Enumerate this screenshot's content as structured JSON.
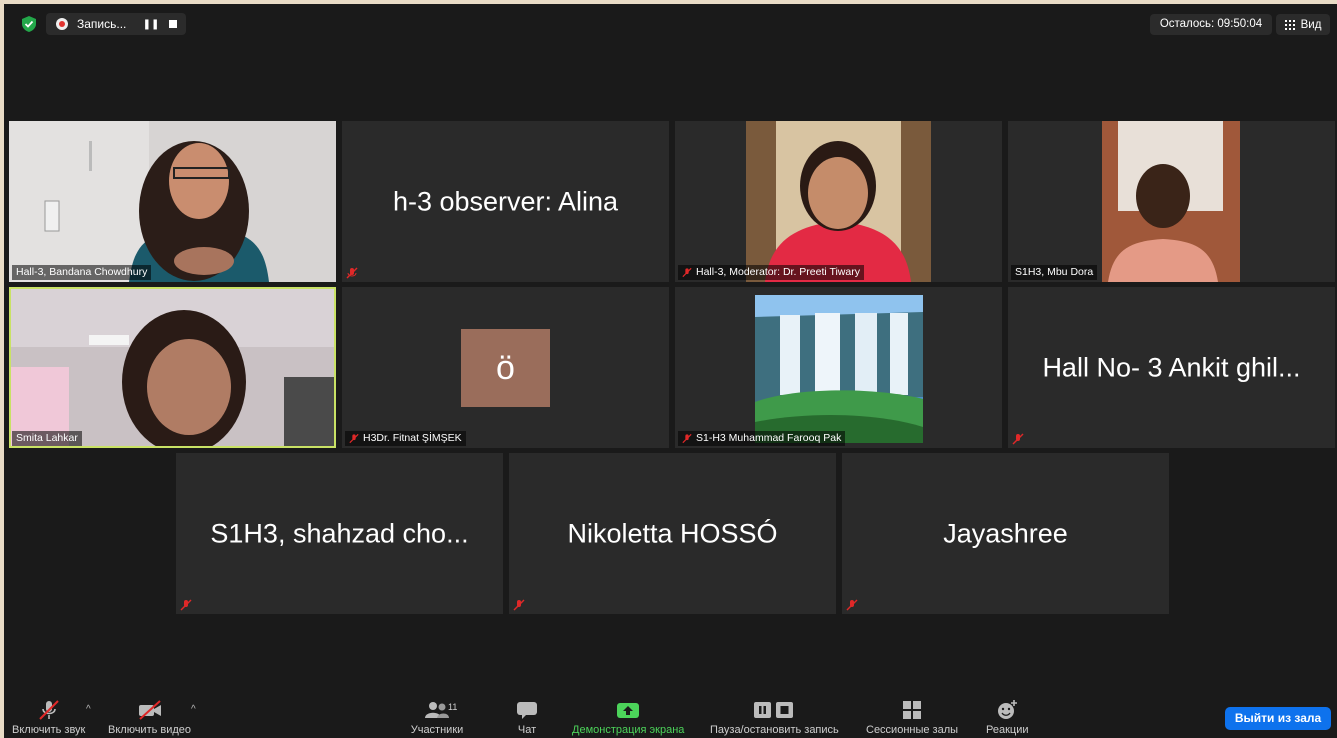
{
  "top_bar": {
    "recording_label": "Запись...",
    "pause_symbol": "❚❚",
    "time_remaining": "Осталось: 09:50:04",
    "view_label": "Вид"
  },
  "tiles": [
    {
      "name": "Hall-3, Bandana Chowdhury",
      "type": "video",
      "muted": false
    },
    {
      "name": "",
      "display_name": "h-3 observer: Alina",
      "type": "name",
      "muted": true
    },
    {
      "name": "Hall-3, Moderator: Dr. Preeti Tiwary",
      "type": "video",
      "muted": true
    },
    {
      "name": "S1H3, Mbu Dora",
      "type": "video",
      "muted": false
    },
    {
      "name": "Smita Lahkar",
      "type": "video",
      "muted": false,
      "active_speaker": true
    },
    {
      "name": "H3Dr. Fitnat ŞİMŞEK",
      "type": "avatar",
      "avatar_letter": "ö",
      "avatar_color": "#9a6d5b",
      "muted": true
    },
    {
      "name": "S1-H3 Muhammad Farooq Pak",
      "type": "picture",
      "muted": true
    },
    {
      "name": "",
      "display_name": "Hall No- 3 Ankit ghil...",
      "type": "name",
      "muted": true
    },
    {
      "name": "",
      "display_name": "S1H3, shahzad cho...",
      "type": "name",
      "muted": true
    },
    {
      "name": "",
      "display_name": "Nikoletta HOSSÓ",
      "type": "name",
      "muted": true
    },
    {
      "name": "",
      "display_name": "Jayashree",
      "type": "name",
      "muted": true
    }
  ],
  "toolbar": {
    "unmute": "Включить звук",
    "start_video": "Включить видео",
    "participants": "Участники",
    "participants_count": "11",
    "chat": "Чат",
    "share_screen": "Демонстрация экрана",
    "pause_stop_recording": "Пауза/остановить запись",
    "breakout_rooms": "Сессионные залы",
    "reactions": "Реакции",
    "leave": "Выйти из зала"
  },
  "colors": {
    "leave_button": "#0e72ed",
    "share_green": "#4cd35a",
    "active_border": "#c9e265",
    "tile_bg": "#2a2a2a"
  }
}
